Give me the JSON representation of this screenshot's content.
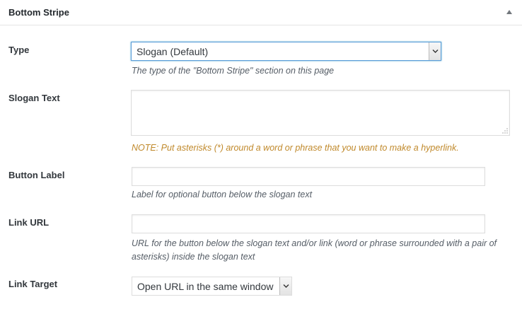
{
  "panel": {
    "title": "Bottom Stripe",
    "toggle_icon": "triangle-up-icon"
  },
  "fields": {
    "type": {
      "label": "Type",
      "selected": "Slogan (Default)",
      "description": "The type of the \"Bottom Stripe\" section on this page"
    },
    "slogan_text": {
      "label": "Slogan Text",
      "value": "",
      "description": "NOTE: Put asterisks (*) around a word or phrase that you want to make a hyperlink."
    },
    "button_label": {
      "label": "Button Label",
      "value": "",
      "description": "Label for optional button below the slogan text"
    },
    "link_url": {
      "label": "Link URL",
      "value": "",
      "description_line1": "URL for the button below the slogan text and/or link (word or phrase surrounded with a pair of",
      "description_line2": "asterisks) inside the slogan text"
    },
    "link_target": {
      "label": "Link Target",
      "selected": "Open URL in the same window"
    }
  },
  "colors": {
    "note_text": "#c0892b",
    "focus_border": "#5b9dd9"
  }
}
